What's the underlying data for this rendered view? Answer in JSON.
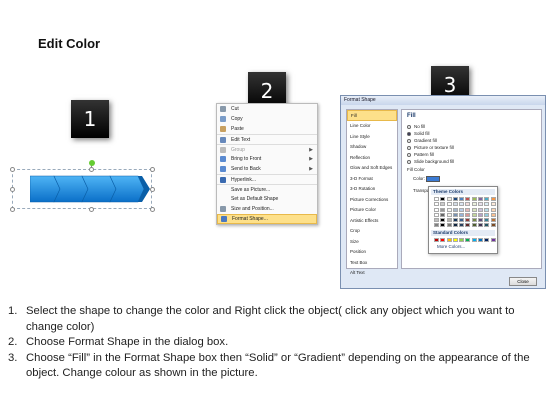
{
  "title": "Edit Color",
  "step_numbers": [
    "1",
    "2",
    "3"
  ],
  "context_menu": {
    "items": [
      {
        "label": "Cut",
        "icon": "scissors-icon"
      },
      {
        "label": "Copy",
        "icon": "copy-icon"
      },
      {
        "label": "Paste",
        "icon": "paste-icon"
      },
      {
        "label": "Edit Text",
        "icon": "edit-text-icon"
      },
      {
        "label": "Group",
        "icon": "group-icon"
      },
      {
        "label": "Bring to Front",
        "icon": "bring-front-icon"
      },
      {
        "label": "Send to Back",
        "icon": "send-back-icon"
      },
      {
        "label": "Hyperlink...",
        "icon": "hyperlink-icon"
      },
      {
        "label": "Save as Picture...",
        "icon": ""
      },
      {
        "label": "Set as Default Shape",
        "icon": ""
      },
      {
        "label": "Size and Position...",
        "icon": "size-icon"
      },
      {
        "label": "Format Shape...",
        "icon": "format-shape-icon"
      }
    ]
  },
  "dialog": {
    "title": "Format Shape",
    "categories": [
      "Fill",
      "Line Color",
      "Line Style",
      "Shadow",
      "Reflection",
      "Glow and Soft Edges",
      "3-D Format",
      "3-D Rotation",
      "Picture Corrections",
      "Picture Color",
      "Artistic Effects",
      "Crop",
      "Size",
      "Position",
      "Text Box",
      "Alt Text"
    ],
    "panel_heading": "Fill",
    "options": [
      "No fill",
      "Solid fill",
      "Gradient fill",
      "Picture or texture fill",
      "Pattern fill",
      "Slide background fill"
    ],
    "fill_color_label": "Fill Color",
    "color_label": "Color:",
    "transparency_label": "Transpa",
    "close_label": "Close"
  },
  "palette": {
    "theme_colors_label": "Theme Colors",
    "standard_colors_label": "Standard Colors",
    "more_colors_label": "More Colors...",
    "theme_row": [
      "#ffffff",
      "#000000",
      "#eeece1",
      "#1f497d",
      "#4f81bd",
      "#c0504d",
      "#9bbb59",
      "#8064a2",
      "#4bacc6",
      "#f79646"
    ],
    "standard_row": [
      "#c00000",
      "#ff0000",
      "#ffc000",
      "#ffff00",
      "#92d050",
      "#00b050",
      "#00b0f0",
      "#0070c0",
      "#002060",
      "#7030a0"
    ]
  },
  "instructions": [
    {
      "n": "1.",
      "text": "Select the shape to change the color and Right click the object( click any object which you want to change color)"
    },
    {
      "n": "2.",
      "text": "Choose Format Shape in the dialog box."
    },
    {
      "n": "3.",
      "text": "Choose “Fill” in the Format Shape box then “Solid” or “Gradient” depending on the appearance of the object. Change colour as shown in the picture."
    }
  ],
  "colors": {
    "arrow_fill": "#1e8ee0",
    "arrow_dark": "#0a5fa8",
    "highlight": "#fde08a"
  }
}
